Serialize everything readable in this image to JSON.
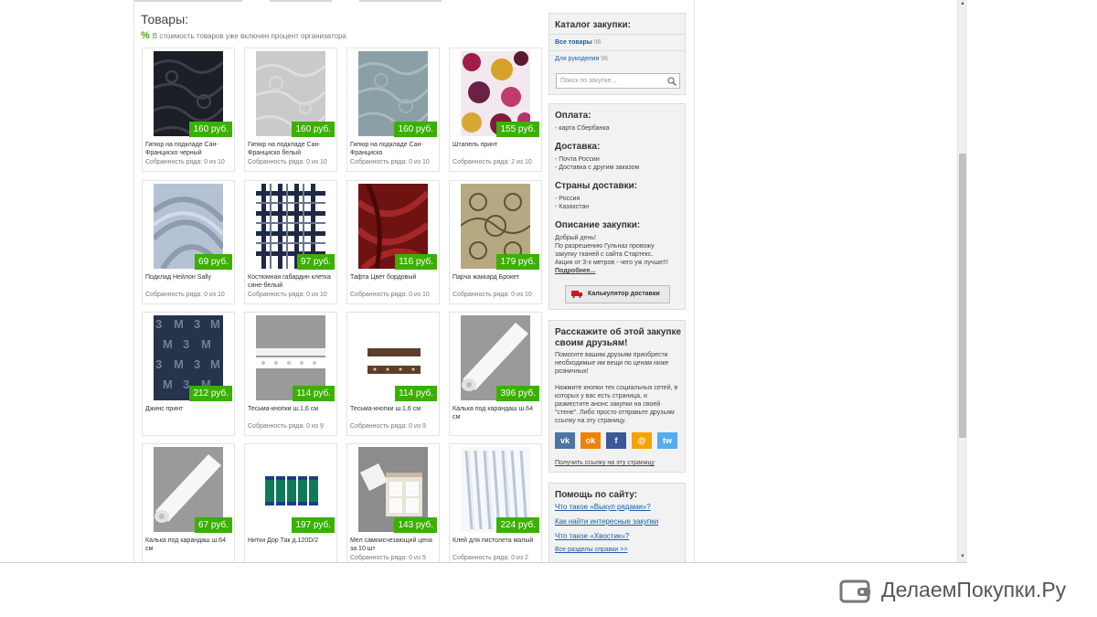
{
  "main": {
    "title": "Товары:",
    "notice_icon": "%",
    "notice": "В стоимость товаров уже включен процент организатора"
  },
  "products": [
    {
      "name": "Гипюр на подкладе Сан-Франциско черный",
      "price": "160 руб.",
      "rows": "Собранность ряда: 0 из 10"
    },
    {
      "name": "Гипюр на подкладе Сан-Франциско белый",
      "price": "160 руб.",
      "rows": "Собранность ряда: 0 из 10"
    },
    {
      "name": "Гипюр на подкладе Сан-Франциско",
      "price": "160 руб.",
      "rows": "Собранность ряда: 0 из 10"
    },
    {
      "name": "Штапель принт",
      "price": "155 руб.",
      "rows": "Собранность ряда: 2 из 10"
    },
    {
      "name": "Подклад Нейлон Sally",
      "price": "69 руб.",
      "rows": "Собранность ряда: 0 из 10"
    },
    {
      "name": "Костюмная габардин клетка сине-белый",
      "price": "97 руб.",
      "rows": "Собранность ряда: 0 из 10"
    },
    {
      "name": "Тафта Цвет бордовый",
      "price": "116 руб.",
      "rows": "Собранность ряда: 0 из 10"
    },
    {
      "name": "Парча жаккард Брокет",
      "price": "179 руб.",
      "rows": "Собранность ряда: 0 из 10"
    },
    {
      "name": "Джинс принт",
      "price": "212 руб.",
      "rows": ""
    },
    {
      "name": "Тесьма-кнопки ш.1,6 см",
      "price": "114 руб.",
      "rows": "Собранность ряда: 0 из 9"
    },
    {
      "name": "Тесьма-кнопки ш.1,6 см",
      "price": "114 руб.",
      "rows": "Собранность ряда: 0 из 9"
    },
    {
      "name": "Калька под карандаш ш.64 см",
      "price": "396 руб.",
      "rows": ""
    },
    {
      "name": "Калька под карандаш ш.64 см",
      "price": "67 руб.",
      "rows": ""
    },
    {
      "name": "Нитки Дор Так д.120D/2",
      "price": "197 руб.",
      "rows": ""
    },
    {
      "name": "Мел самоисчезающий цена за 10 шт",
      "price": "143 руб.",
      "rows": "Собранность ряда: 0 из 5"
    },
    {
      "name": "Клей для пистолета малый",
      "price": "224 руб.",
      "rows": "Собранность ряда: 0 из 2"
    }
  ],
  "catalog": {
    "title": "Каталог закупки:",
    "items": [
      {
        "label": "Все товары",
        "count": "96"
      },
      {
        "label": "Для рукоделия",
        "count": "96"
      }
    ],
    "search_placeholder": "Поиск по закупке..."
  },
  "info": {
    "payment_title": "Оплата:",
    "payment": "- карта Сбербанка",
    "delivery_title": "Доставка:",
    "delivery_1": "- Почта России",
    "delivery_2": "- Доставка с другим заказом",
    "countries_title": "Страны доставки:",
    "country_1": "- Россия",
    "country_2": "- Казахстан",
    "description_title": "Описание закупки:",
    "description_1": "Добрый день!",
    "description_2": "По разрешению Гульназ провожу",
    "description_3": "закупку тканей с сайта Стартекс.",
    "description_4": "Акция от 3-х метров - чего уж лучше!!!",
    "more_link": "Подробнее...",
    "calc_button": "Калькулятор доставки"
  },
  "share": {
    "title": "Расскажите об этой закупке своим друзьям!",
    "text_1": "Помогите вашим друзьям приобрести необходимые им вещи по ценам ниже розничных!",
    "text_2": "Нажмите кнопки тех социальных сетей, в которых у вас есть страница, и разместите анонс закупки на своей \"стене\". Либо просто отправьте друзьям ссылку на эту страницу.",
    "link": "Получить ссылку на эту страницу",
    "networks": [
      {
        "label": "vk",
        "color": "#4c75a3"
      },
      {
        "label": "ok",
        "color": "#ee8208"
      },
      {
        "label": "f",
        "color": "#3b5998"
      },
      {
        "label": "@",
        "color": "#f5a300"
      },
      {
        "label": "tw",
        "color": "#55acee"
      }
    ]
  },
  "help": {
    "title": "Помощь по сайту:",
    "links": [
      "Что такое «Выкуп рядами»?",
      "Как найти интересные закупки",
      "Что такое «Хвостик»?",
      "Все разделы справки >>"
    ]
  },
  "brand": {
    "name": "ДелаемПокупки.Ру"
  },
  "colors": {
    "price_badge": "#3bb000",
    "link": "#1c5ca8"
  }
}
